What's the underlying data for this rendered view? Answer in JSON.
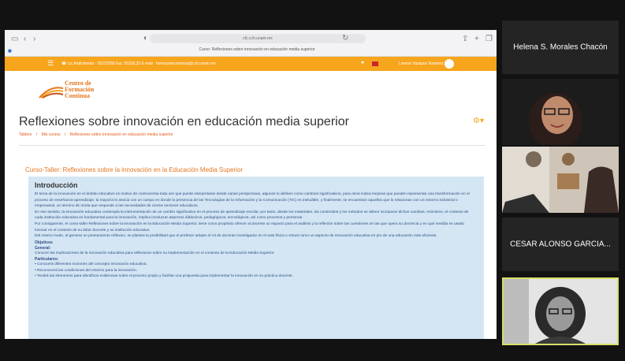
{
  "browser": {
    "url": "cfc.cch.unam.mx",
    "tab_title": "Curso: Reflexiones sobre innovación en educación media superior"
  },
  "site": {
    "contact": "☎ Lic.Andrómeda · 56232058 Ext. 55338,33 E-mail · formacioncontinua@cch.unam.mx",
    "user_name": "Lorena Vázquez Ramírez",
    "logo": [
      "Centro de",
      "Formación",
      "Continua"
    ]
  },
  "course": {
    "title": "Reflexiones sobre innovación en educación media superior",
    "breadcrumb": [
      "Tablero",
      "/",
      "Mis cursos",
      "/",
      "Reflexiones sobre innovación en educación media superior"
    ],
    "section_title": "Curso-Taller: Reflexiones sobre la innovación en la Educación Media Superior",
    "intro_heading": "Introducción",
    "paragraphs": [
      "El tema de la innovación en el ámbito educativo es motivo de controversia toda vez que puede interpretarse desde varias perspectivas, algunos lo definen como cambios significativos, para otros indica mejoras que pueden representar una transformación en el proceso de enseñanza-aprendizaje, la mayoría lo asocia con un campo en donde la presencia de las Tecnologías de la Información y la Comunicación (TIC) es ineludible, y finalmente, se encuentran aquellos que lo relacionan con un entorno industrial o empresarial, un término de moda que responde a las necesidades de ciertos sectores educativos.",
      "En ese sentido, la innovación educativa contempla la instrumentación de un cambio significativo en el proceso de aprendizaje escolar, por tanto, desde los materiales, los contenidos y los métodos se deben incorporar dichos cambios. Asimismo, el contexto de cada institución educativa es fundamental para la innovación, implica involucrar aspectos didácticos, pedagógicos, tecnológicos, así como procesos y personas.",
      "Por consiguiente, el curso-taller Reflexiones sobre la innovación en la Educación Media Superior, tiene como propósito ofrecer al docente un espacio para el análisis y la reflexión sobre las cuestiones en las que opera su docencia y en qué medida es usado innovar en el contexto de su labor docente y su institución educativa.",
      "Del mismo modo, al generar un pensamiento reflexivo, se plantea la posibilidad que el profesor adopte el rol de docente investigador en el aula física o virtual como un aspecto de innovación educativa en pro de una educación más eficiente."
    ],
    "objetivos_label": "Objetivos",
    "general_label": "General:",
    "general_text": "Conocer las implicaciones de la innovación educativa para reflexionar sobre su implementación en el contexto de la Educación Media Superior.",
    "particulares_label": "Particulares:",
    "particulares": [
      "Conocerá diferentes nociones del concepto innovación educativa.",
      "Reconocerá las condiciones del entorno para la innovación.",
      "Tendrá las elementos para identificar evidencias sobre el proceso propio y facilitar una propuesta para implementar la innovación en su práctica docente."
    ]
  },
  "participants": [
    {
      "name": "Helena S. Morales Chacón"
    },
    {
      "name": ""
    },
    {
      "name": ""
    },
    {
      "name": "CESAR ALONSO GARCIA..."
    },
    {
      "name": ""
    }
  ]
}
